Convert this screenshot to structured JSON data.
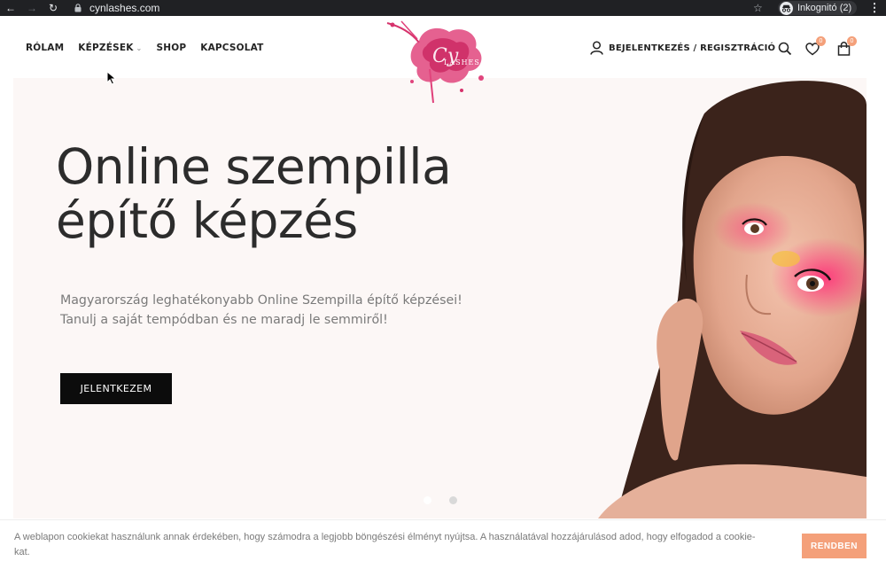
{
  "browser": {
    "url": "cynlashes.com",
    "incognito_label": "Inkognitó (2)",
    "icons": [
      "back-arrow-icon",
      "forward-arrow-icon",
      "reload-icon",
      "lock-icon",
      "star-icon",
      "incognito-icon",
      "kebab-menu-icon"
    ]
  },
  "header": {
    "menu": [
      {
        "label": "RÓLAM"
      },
      {
        "label": "KÉPZÉSEK",
        "has_dropdown": true
      },
      {
        "label": "SHOP"
      },
      {
        "label": "KAPCSOLAT"
      }
    ],
    "logo_text": "Cyn LASHES",
    "account_label": "BEJELENTKEZÉS / REGISZTRÁCIÓ",
    "wishlist_count": "0",
    "cart_count": "0",
    "icons": [
      "user-icon",
      "search-icon",
      "heart-icon",
      "shopping-bag-icon"
    ]
  },
  "hero": {
    "title_line1": "Online szempilla",
    "title_line2": "építő képzés",
    "subtitle_line1": "Magyarország leghatékonyabb Online Szempilla építő képzései!",
    "subtitle_line2": "Tanulj a saját tempódban és ne maradj le semmiről!",
    "button_label": "JELENTKEZEM",
    "slides": 2,
    "active_slide": 1
  },
  "cookie": {
    "text": "A weblapon cookiekat használunk annak érdekében, hogy számodra a legjobb böngészési élményt nyújtsa. A használatával hozzájárulásod adod, hogy elfogadod a cookie-kat.",
    "button_label": "RENDBEN"
  },
  "colors": {
    "accent": "#f4a07a",
    "hero_bg": "#fcf7f6",
    "button_dark": "#0c0c0c",
    "text_dark": "#2c2c2c",
    "text_muted": "#7a7a7a"
  }
}
